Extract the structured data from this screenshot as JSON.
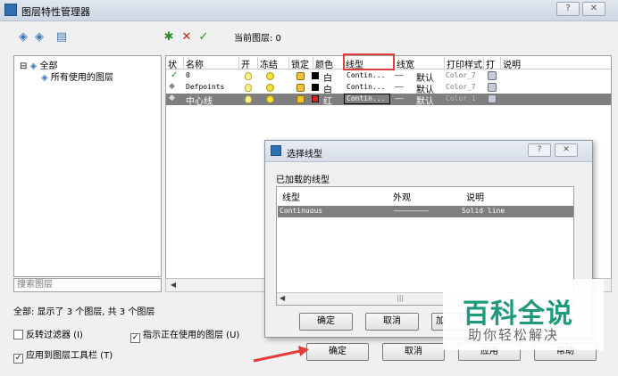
{
  "window": {
    "title": "图层特性管理器",
    "help_btn": "?",
    "close_btn": "✕"
  },
  "toolbar": {
    "current_layer_label": "当前图层: 0"
  },
  "tree": {
    "root": "全部",
    "child": "所有使用的图层"
  },
  "search": {
    "placeholder": "搜索图层"
  },
  "columns": [
    "状",
    "名称",
    "开",
    "冻结",
    "锁定",
    "颜色",
    "线型",
    "线宽",
    "打印样式",
    "打",
    "说明"
  ],
  "layers": [
    {
      "name": "0",
      "color_name": "白",
      "color": "#000000",
      "linetype": "Contin...",
      "lineweight": "默认",
      "plot_style": "Color_7"
    },
    {
      "name": "Defpoints",
      "color_name": "白",
      "color": "#000000",
      "linetype": "Contin...",
      "lineweight": "默认",
      "plot_style": "Color_7"
    },
    {
      "name": "中心线",
      "color_name": "红",
      "color": "#e02020",
      "linetype": "Contin...",
      "lineweight": "默认",
      "plot_style": "Color_1"
    }
  ],
  "status": {
    "text": "全部: 显示了 3 个图层, 共 3 个图层"
  },
  "options": {
    "invert_filter": "反转过滤器 (I)",
    "indicate_in_use": "指示正在使用的图层 (U)",
    "apply_to_toolbar": "应用到图层工具栏 (T)"
  },
  "buttons": {
    "ok": "确定",
    "cancel": "取消",
    "apply": "应用",
    "help": "帮助"
  },
  "dialog": {
    "title": "选择线型",
    "help_btn": "?",
    "close_btn": "✕",
    "loaded_label": "已加载的线型",
    "columns": [
      "线型",
      "外观",
      "说明"
    ],
    "rows": [
      {
        "linetype": "Continuous",
        "appearance": "————————",
        "description": "Solid line"
      }
    ],
    "ok": "确定",
    "cancel": "取消",
    "add": "加"
  },
  "watermark": {
    "brand": "百科全说",
    "tagline": "助你轻松解决"
  }
}
